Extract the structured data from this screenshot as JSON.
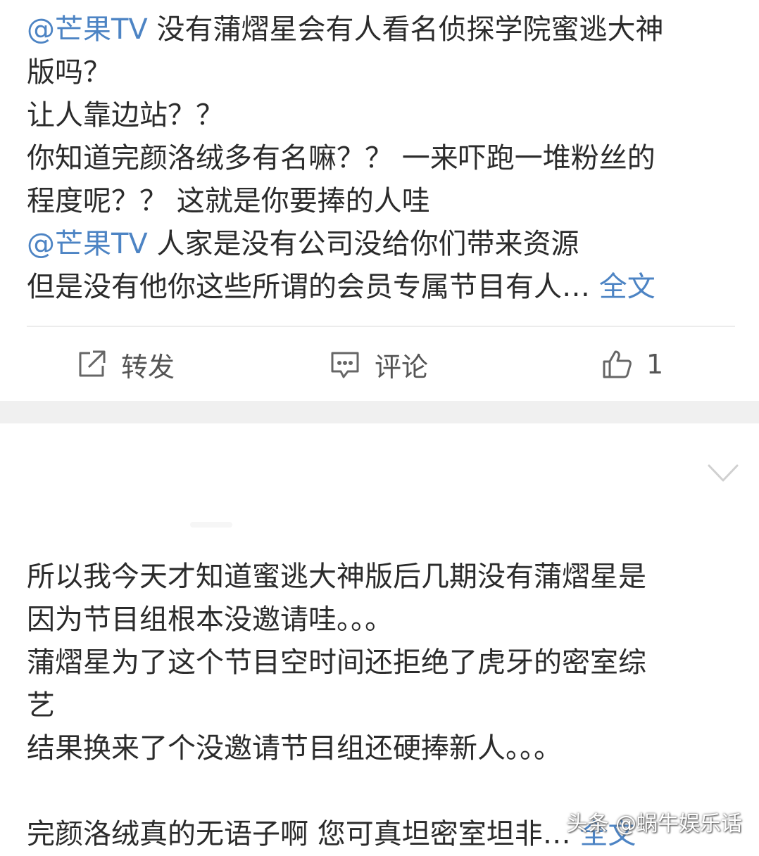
{
  "post1": {
    "lines": [
      {
        "mention": "@芒果TV",
        "text": " 没有蒲熠星会有人看名侦探学院蜜逃大神"
      },
      {
        "text": "版吗？"
      },
      {
        "text": "让人靠边站？？"
      },
      {
        "text": "你知道完颜洛绒多有名嘛？？ 一来吓跑一堆粉丝的"
      },
      {
        "text": "程度呢？？ 这就是你要捧的人哇"
      },
      {
        "mention": "@芒果TV",
        "text": " 人家是没有公司没给你们带来资源"
      },
      {
        "text": "但是没有他你这些所谓的会员专属节目有人… ",
        "more": "全文"
      }
    ],
    "actions": {
      "repost": "转发",
      "comment": "评论",
      "like_count": "1"
    }
  },
  "post2": {
    "lines": [
      "所以我今天才知道蜜逃大神版后几期没有蒲熠星是",
      "因为节目组根本没邀请哇。。。",
      "蒲熠星为了这个节目空时间还拒绝了虎牙的密室综",
      "艺",
      "结果换来了个没邀请节目组还硬捧新人。。。",
      "",
      "完颜洛绒真的无语子啊 您可真坦密室坦非… "
    ],
    "more": "全文"
  },
  "watermark": "头条 @蜗牛娱乐话",
  "colors": {
    "accent": "#4d84c4",
    "text": "#2b2b2b",
    "band": "#f0f0f0"
  }
}
